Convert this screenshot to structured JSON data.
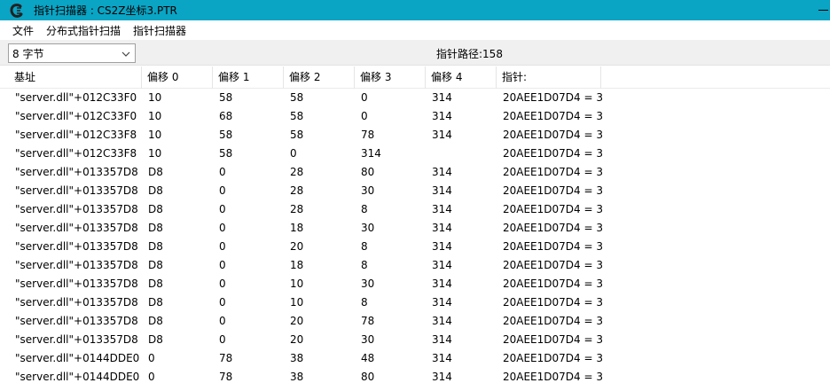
{
  "window": {
    "title": "指针扫描器 : CS2Z坐标3.PTR"
  },
  "menu": {
    "items": [
      "文件",
      "分布式指针扫描",
      "指针扫描器"
    ]
  },
  "toolbar": {
    "size_value": "8 字节",
    "path_label": "指针路径:158"
  },
  "table": {
    "headers": [
      "基址",
      "偏移 0",
      "偏移 1",
      "偏移 2",
      "偏移 3",
      "偏移 4",
      "指针:"
    ],
    "rows": [
      [
        "\"server.dll\"+012C33F0",
        "10",
        "58",
        "58",
        "0",
        "314",
        "20AEE1D07D4 = 3"
      ],
      [
        "\"server.dll\"+012C33F0",
        "10",
        "68",
        "58",
        "0",
        "314",
        "20AEE1D07D4 = 3"
      ],
      [
        "\"server.dll\"+012C33F8",
        "10",
        "58",
        "58",
        "78",
        "314",
        "20AEE1D07D4 = 3"
      ],
      [
        "\"server.dll\"+012C33F8",
        "10",
        "58",
        "0",
        "314",
        "",
        "20AEE1D07D4 = 3"
      ],
      [
        "\"server.dll\"+013357D8",
        "D8",
        "0",
        "28",
        "80",
        "314",
        "20AEE1D07D4 = 3"
      ],
      [
        "\"server.dll\"+013357D8",
        "D8",
        "0",
        "28",
        "30",
        "314",
        "20AEE1D07D4 = 3"
      ],
      [
        "\"server.dll\"+013357D8",
        "D8",
        "0",
        "28",
        "8",
        "314",
        "20AEE1D07D4 = 3"
      ],
      [
        "\"server.dll\"+013357D8",
        "D8",
        "0",
        "18",
        "30",
        "314",
        "20AEE1D07D4 = 3"
      ],
      [
        "\"server.dll\"+013357D8",
        "D8",
        "0",
        "20",
        "8",
        "314",
        "20AEE1D07D4 = 3"
      ],
      [
        "\"server.dll\"+013357D8",
        "D8",
        "0",
        "18",
        "8",
        "314",
        "20AEE1D07D4 = 3"
      ],
      [
        "\"server.dll\"+013357D8",
        "D8",
        "0",
        "10",
        "30",
        "314",
        "20AEE1D07D4 = 3"
      ],
      [
        "\"server.dll\"+013357D8",
        "D8",
        "0",
        "10",
        "8",
        "314",
        "20AEE1D07D4 = 3"
      ],
      [
        "\"server.dll\"+013357D8",
        "D8",
        "0",
        "20",
        "78",
        "314",
        "20AEE1D07D4 = 3"
      ],
      [
        "\"server.dll\"+013357D8",
        "D8",
        "0",
        "20",
        "30",
        "314",
        "20AEE1D07D4 = 3"
      ],
      [
        "\"server.dll\"+0144DDE0",
        "0",
        "78",
        "38",
        "48",
        "314",
        "20AEE1D07D4 = 3"
      ],
      [
        "\"server.dll\"+0144DDE0",
        "0",
        "78",
        "38",
        "80",
        "314",
        "20AEE1D07D4 = 3"
      ]
    ]
  },
  "colors": {
    "titlebar": "#0aa4c4",
    "toolbar": "#f0f0f0"
  }
}
